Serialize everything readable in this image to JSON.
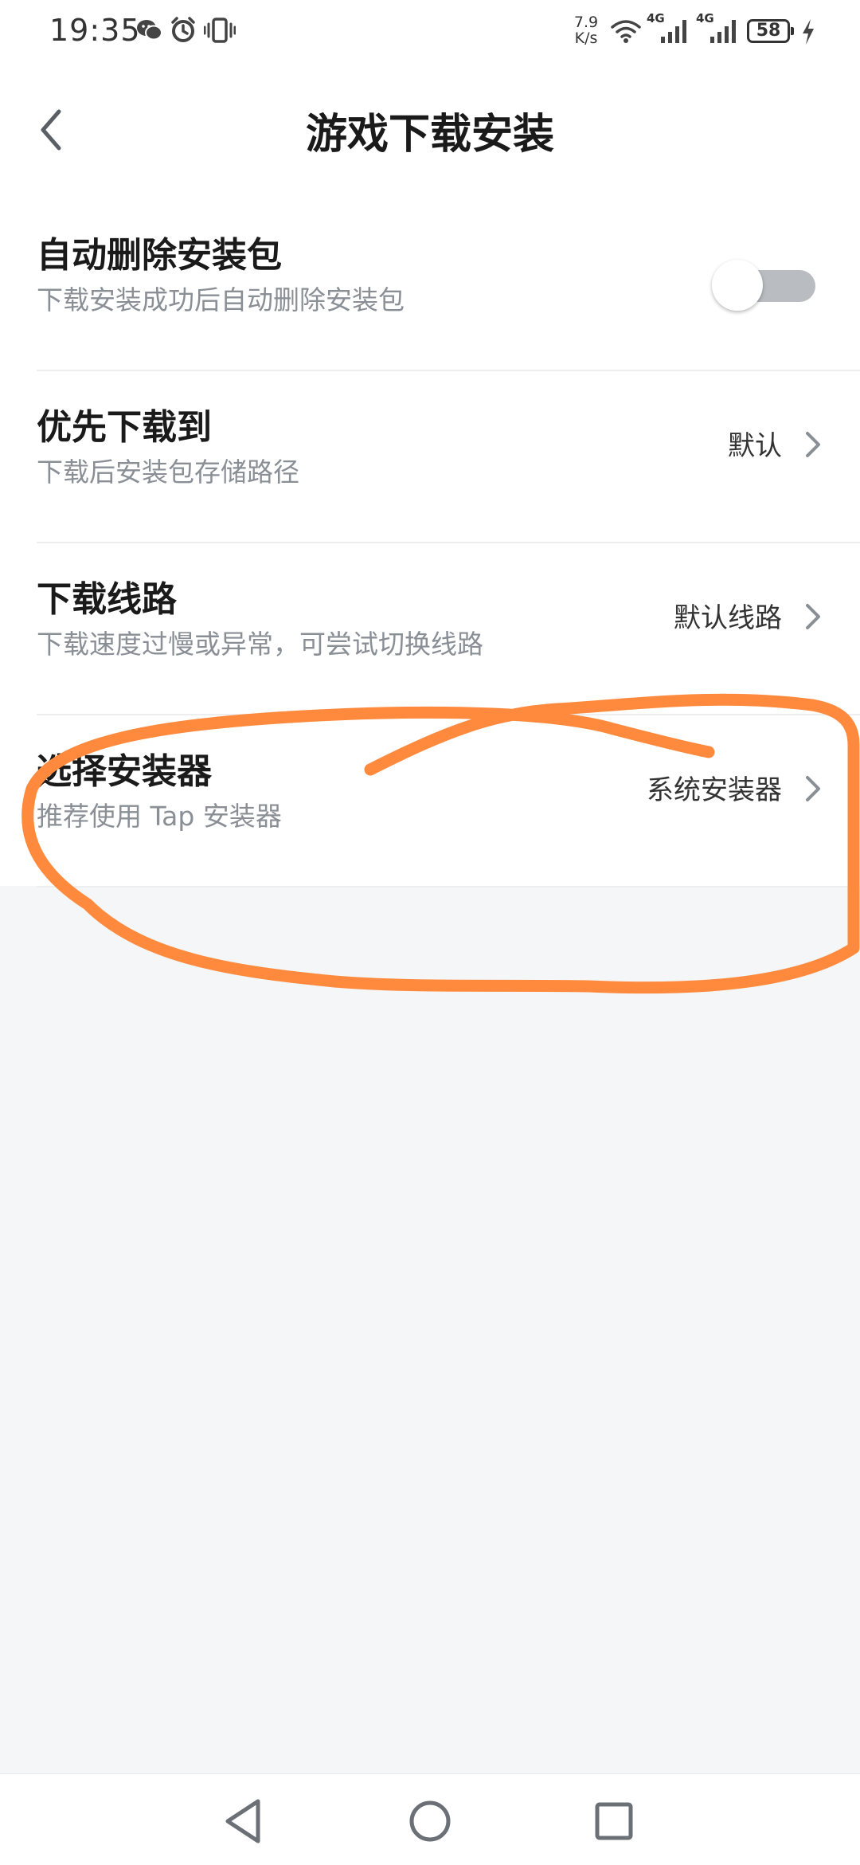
{
  "status_bar": {
    "time": "19:35",
    "net_speed_value": "7.9",
    "net_speed_unit": "K/s",
    "net1": "4G",
    "net2": "4G",
    "battery": "58"
  },
  "header": {
    "title": "游戏下载安装"
  },
  "settings": [
    {
      "title": "自动删除安装包",
      "subtitle": "下载安装成功后自动删除安装包",
      "control": "toggle",
      "toggle_on": false
    },
    {
      "title": "优先下载到",
      "subtitle": "下载后安装包存储路径",
      "value": "默认"
    },
    {
      "title": "下载线路",
      "subtitle": "下载速度过慢或异常，可尝试切换线路",
      "value": "默认线路"
    },
    {
      "title": "选择安装器",
      "subtitle": "推荐使用 Tap 安装器",
      "value": "系统安装器"
    }
  ],
  "colors": {
    "annotation": "#ff8a3d",
    "background": "#f4f6f8",
    "toggle_track_off": "#b9bcc0"
  },
  "icons": {
    "back": "chevron-left-icon",
    "chevron": "chevron-right-icon",
    "nav_back": "triangle-back-icon",
    "nav_home": "circle-home-icon",
    "nav_recents": "square-recents-icon"
  }
}
